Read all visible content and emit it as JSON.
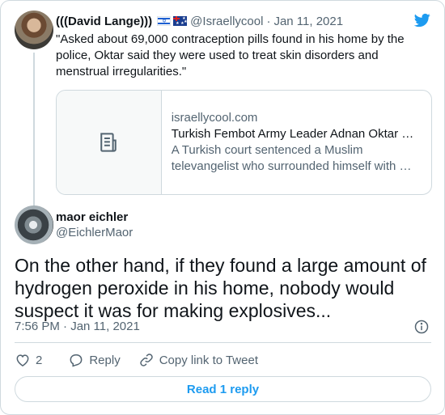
{
  "colors": {
    "accent": "#1d9bf0",
    "secondary_text": "#536471",
    "border": "#cfd9de"
  },
  "parent_tweet": {
    "display_name": "(((David Lange)))",
    "handle": "@Israellycool",
    "separator": "·",
    "date": "Jan 11, 2021",
    "flags": [
      "israel-flag-icon",
      "australia-flag-icon"
    ],
    "text": "\"Asked about 69,000 contraception pills found in his home by the police, Oktar said they were used to treat skin disorders and menstrual irregularities.\"",
    "link_card": {
      "domain": "israellycool.com",
      "title": "Turkish Fembot Army Leader Adnan Oktar …",
      "description_line1": "A Turkish court sentenced a Muslim",
      "description_line2": "televangelist who surrounded himself with …",
      "thumb_icon": "document-icon"
    }
  },
  "main_tweet": {
    "display_name": "maor eichler",
    "handle": "@EichlerMaor",
    "text": "On the other hand, if they found a large amount of hydrogen peroxide in his home, nobody would suspect it was for making explosives...",
    "timestamp": "7:56 PM · Jan 11, 2021",
    "likes": "2",
    "reply_label": "Reply",
    "copy_link_label": "Copy link to Tweet",
    "read_replies_label": "Read 1 reply"
  }
}
